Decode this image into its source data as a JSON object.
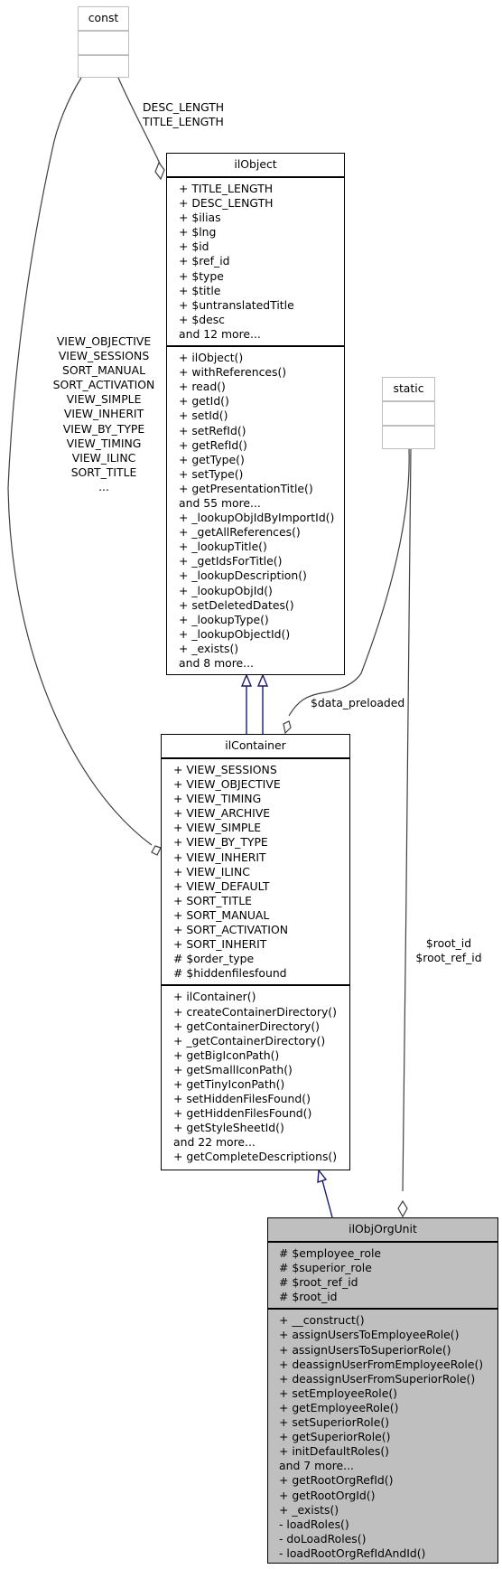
{
  "classes": {
    "const": {
      "name": "const",
      "attributes": [],
      "methods": []
    },
    "static": {
      "name": "static",
      "attributes": [],
      "methods": []
    },
    "ilObject": {
      "name": "ilObject",
      "attributes": [
        "+ TITLE_LENGTH",
        "+ DESC_LENGTH",
        "+ $ilias",
        "+ $lng",
        "+ $id",
        "+ $ref_id",
        "+ $type",
        "+ $title",
        "+ $untranslatedTitle",
        "+ $desc",
        "and 12 more..."
      ],
      "methods": [
        "+ ilObject()",
        "+ withReferences()",
        "+ read()",
        "+ getId()",
        "+ setId()",
        "+ setRefId()",
        "+ getRefId()",
        "+ getType()",
        "+ setType()",
        "+ getPresentationTitle()",
        "and 55 more...",
        "+ _lookupObjIdByImportId()",
        "+ _getAllReferences()",
        "+ _lookupTitle()",
        "+ _getIdsForTitle()",
        "+ _lookupDescription()",
        "+ _lookupObjId()",
        "+ setDeletedDates()",
        "+ _lookupType()",
        "+ _lookupObjectId()",
        "+ _exists()",
        "and 8 more..."
      ]
    },
    "ilContainer": {
      "name": "ilContainer",
      "attributes": [
        "+ VIEW_SESSIONS",
        "+ VIEW_OBJECTIVE",
        "+ VIEW_TIMING",
        "+ VIEW_ARCHIVE",
        "+ VIEW_SIMPLE",
        "+ VIEW_BY_TYPE",
        "+ VIEW_INHERIT",
        "+ VIEW_ILINC",
        "+ VIEW_DEFAULT",
        "+ SORT_TITLE",
        "+ SORT_MANUAL",
        "+ SORT_ACTIVATION",
        "+ SORT_INHERIT",
        "# $order_type",
        "# $hiddenfilesfound"
      ],
      "methods": [
        "+ ilContainer()",
        "+ createContainerDirectory()",
        "+ getContainerDirectory()",
        "+ _getContainerDirectory()",
        "+ getBigIconPath()",
        "+ getSmallIconPath()",
        "+ getTinyIconPath()",
        "+ setHiddenFilesFound()",
        "+ getHiddenFilesFound()",
        "+ getStyleSheetId()",
        "and 22 more...",
        "+ getCompleteDescriptions()"
      ]
    },
    "ilObjOrgUnit": {
      "name": "ilObjOrgUnit",
      "attributes": [
        "# $employee_role",
        "# $superior_role",
        "# $root_ref_id",
        "# $root_id"
      ],
      "methods": [
        "+ __construct()",
        "+ assignUsersToEmployeeRole()",
        "+ assignUsersToSuperiorRole()",
        "+ deassignUserFromEmployeeRole()",
        "+ deassignUserFromSuperiorRole()",
        "+ setEmployeeRole()",
        "+ getEmployeeRole()",
        "+ setSuperiorRole()",
        "+ getSuperiorRole()",
        "+ initDefaultRoles()",
        "and 7 more...",
        "+ getRootOrgRefId()",
        "+ getRootOrgId()",
        "+ _exists()",
        "- loadRoles()",
        "- doLoadRoles()",
        "- loadRootOrgRefIdAndId()"
      ]
    }
  },
  "edge_labels": {
    "const_to_ilObject": [
      "DESC_LENGTH",
      "TITLE_LENGTH"
    ],
    "const_to_ilContainer": [
      "VIEW_OBJECTIVE",
      "VIEW_SESSIONS",
      "SORT_MANUAL",
      "SORT_ACTIVATION",
      "VIEW_SIMPLE",
      "VIEW_INHERIT",
      "VIEW_BY_TYPE",
      "VIEW_TIMING",
      "VIEW_ILINC",
      "SORT_TITLE",
      "..."
    ],
    "static_to_ilContainer": [
      "$data_preloaded"
    ],
    "static_to_ilObjOrgUnit": [
      "$root_id",
      "$root_ref_id"
    ]
  },
  "colors": {
    "inheritance_edge": "#191970",
    "usage_edge": "#404040",
    "focus_class_fill": "#bfbfbf",
    "ghost_class_border": "#bfbfbf"
  }
}
